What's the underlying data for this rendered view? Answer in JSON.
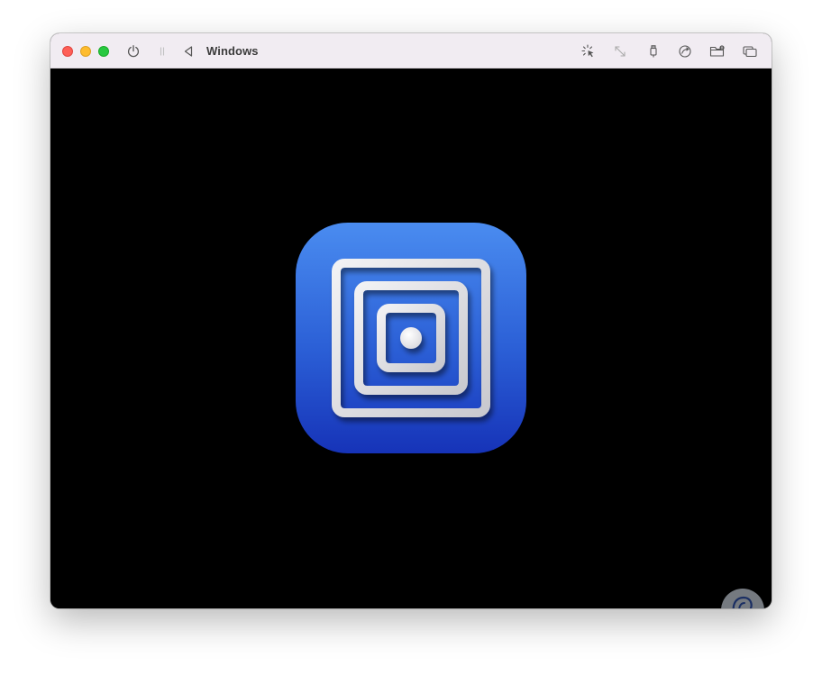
{
  "window": {
    "title": "Windows"
  },
  "toolbar": {
    "left_icons": [
      "power-icon",
      "pause-icon",
      "back-icon"
    ],
    "right_icons": [
      "capture-mouse-icon",
      "resize-icon",
      "usb-icon",
      "share-icon",
      "folder-share-icon",
      "windows-icon"
    ]
  },
  "colors": {
    "titlebar": "#f1ecf2",
    "screen": "#000000",
    "logo_top": "#4a8cf0",
    "logo_bottom": "#1633b8",
    "close": "#fe5f57",
    "minimize": "#febc2e",
    "maximize": "#28c840"
  },
  "screen": {
    "logo": "utm-logo-icon",
    "watermark": "watermark-logo"
  }
}
